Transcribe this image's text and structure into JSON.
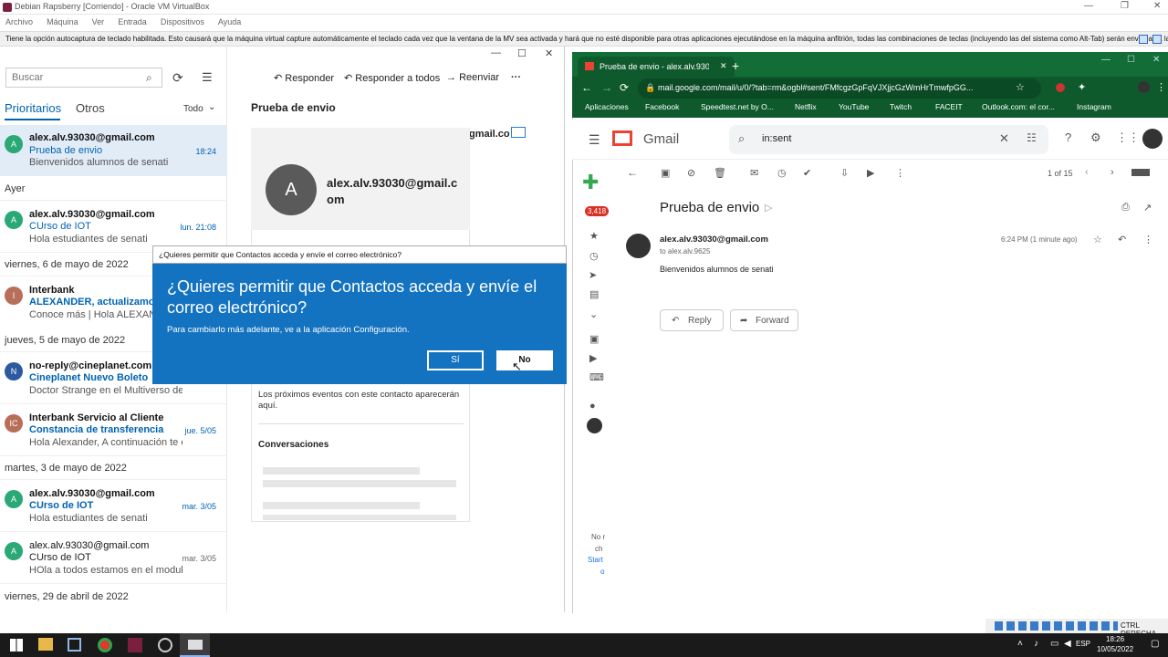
{
  "vbox": {
    "title": "Debian Rapsberry [Corriendo] - Oracle VM VirtualBox",
    "menu": [
      "Archivo",
      "Máquina",
      "Ver",
      "Entrada",
      "Dispositivos",
      "Ayuda"
    ],
    "notice": "Tiene la opción autocaptura de teclado habilitada. Esto causará que la máquina virtual capture automáticamente el teclado cada vez que la ventana de la MV sea activada y hará que no esté disponible para otras aplicaciones ejecutándose en la máquina anfitrión, todas las combinaciones de teclas (incluyendo las del sistema como Alt-Tab) serán enviadas a la MV.",
    "status_right": "CTRL DERECHA"
  },
  "mail": {
    "search_placeholder": "Buscar",
    "tab_focused": "Prioritarios",
    "tab_other": "Otros",
    "filter": "Todo",
    "sections": {
      "ayer": "Ayer",
      "may6": "viernes, 6 de mayo de 2022",
      "may5": "jueves, 5 de mayo de 2022",
      "may3": "martes, 3 de mayo de 2022",
      "apr29": "viernes, 29 de abril de 2022"
    },
    "messages": [
      {
        "initial": "A",
        "from": "alex.alv.93030@gmail.com",
        "subject": "Prueba de envio",
        "preview": "Bienvenidos alumnos de senati",
        "date": "18:24"
      },
      {
        "initial": "A",
        "from": "alex.alv.93030@gmail.com",
        "subject": "CUrso de IOT",
        "preview": "Hola estudiantes de senati",
        "date": "lun. 21:08"
      },
      {
        "initial": "I",
        "from": "Interbank",
        "subject": "ALEXANDER, actualizamos el t",
        "preview": "Conoce más | Hola ALEXANDER",
        "date": ""
      },
      {
        "initial": "N",
        "from": "no-reply@cineplanet.com.pe",
        "subject": "Cineplanet Nuevo Boleto",
        "preview": "Doctor Strange en el Multiverso de la",
        "date": ""
      },
      {
        "initial": "IC",
        "from": "Interbank Servicio al Cliente",
        "subject": "Constancia de transferencia",
        "preview": "Hola Alexander, A continuación te en",
        "date": "jue. 5/05"
      },
      {
        "initial": "A",
        "from": "alex.alv.93030@gmail.com",
        "subject": "CUrso de IOT",
        "preview": "Hola estudiantes de senati",
        "date": "mar. 3/05"
      },
      {
        "initial": "A",
        "from": "alex.alv.93030@gmail.com",
        "subject": "CUrso de IOT",
        "preview": "HOla a todos estamos en el modulo ·",
        "date": "mar. 3/05"
      }
    ],
    "reading": {
      "reply": "Responder",
      "reply_all": "Responder a todos",
      "forward": "Reenviar",
      "more": "···",
      "subject": "Prueba de envio",
      "sender_partial": "gmail.co",
      "contact_initial": "A",
      "contact_email": "alex.alv.93030@gmail.com",
      "events_text": "Los próximos eventos con este contacto aparecerán aquí.",
      "conversations": "Conversaciones"
    }
  },
  "dialog": {
    "title": "¿Quieres permitir que Contactos acceda y envíe el correo electrónico?",
    "question": "¿Quieres permitir que Contactos acceda y envíe el correo electrónico?",
    "subtitle": "Para cambiarlo más adelante, ve a la aplicación Configuración.",
    "yes": "Sí",
    "no": "No"
  },
  "chrome": {
    "tab_title": "Prueba de envio - alex.alv.9303",
    "url": "mail.google.com/mail/u/0/?tab=rm&ogbl#sent/FMfcgzGpFqVJXjjcGzWmHrTmwfpGG...",
    "bookmarks": [
      "Aplicaciones",
      "Facebook",
      "Speedtest.net by O...",
      "Netflix",
      "YouTube",
      "Twitch",
      "FACEIT",
      "Outlook.com: el cor...",
      "Instagram"
    ]
  },
  "gmail": {
    "logo": "Gmail",
    "search_value": "in:sent",
    "count": "1 of 15",
    "badge": "3,418",
    "subject": "Prueba de envio",
    "from": "alex.alv.93030@gmail.com",
    "to": "to alex.alv.9625",
    "time": "6:24 PM (1 minute ago)",
    "body": "Bienvenidos alumnos de senati",
    "reply": "Reply",
    "forward": "Forward",
    "side_text": [
      "No r",
      "ch",
      "Start",
      "o"
    ]
  },
  "taskbar": {
    "lang": "ESP",
    "time": "18:26",
    "date": "10/05/2022"
  },
  "colors": {
    "dialog_blue": "#1473c0",
    "outlook_blue": "#0063b1",
    "chrome_green": "#136d36"
  }
}
